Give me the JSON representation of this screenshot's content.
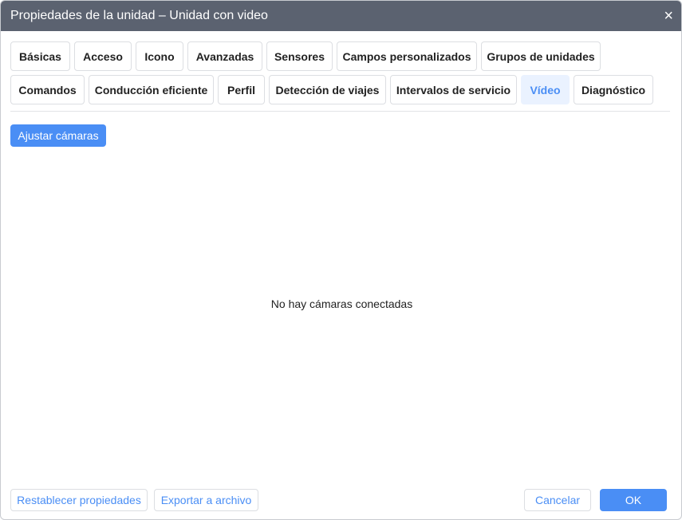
{
  "title": "Propiedades de la unidad – Unidad con video",
  "close_icon": "×",
  "tabs_row1": [
    "Básicas",
    "Acceso",
    "Icono",
    "Avanzadas",
    "Sensores",
    "Campos personalizados",
    "Grupos de unidades"
  ],
  "tabs_row2": [
    "Comandos",
    "Conducción eficiente",
    "Perfil",
    "Detección de viajes",
    "Intervalos de servicio",
    "Vídeo",
    "Diagnóstico"
  ],
  "active_tab": "Vídeo",
  "adjust_cameras": "Ajustar cámaras",
  "empty_message": "No hay cámaras conectadas",
  "footer": {
    "reset": "Restablecer propiedades",
    "export": "Exportar a archivo",
    "cancel": "Cancelar",
    "ok": "OK"
  }
}
